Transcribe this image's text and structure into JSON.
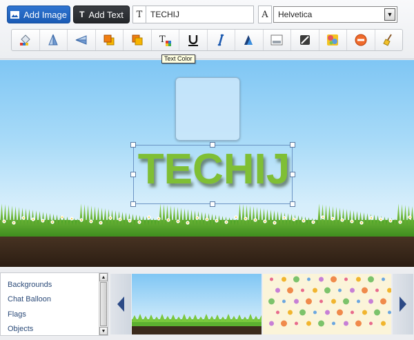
{
  "toolbar": {
    "add_image_label": "Add Image",
    "add_text_label": "Add Text",
    "text_prefix": "T",
    "text_value": "TECHIJ",
    "font_prefix": "A",
    "font_value": "Helvetica",
    "tools": [
      "fill-color-icon",
      "flip-vertical-icon",
      "flip-horizontal-icon",
      "bring-forward-icon",
      "send-backward-icon",
      "text-color-icon",
      "underline-icon",
      "italic-icon",
      "text-shadow-icon",
      "image-frame-icon",
      "no-fill-icon",
      "image-filter-icon",
      "delete-icon",
      "clear-icon"
    ],
    "tooltip": "Text Color"
  },
  "canvas": {
    "text": "TECHIJ",
    "text_color": "#7fbf35"
  },
  "categories": [
    "Backgrounds",
    "Chat Balloon",
    "Flags",
    "Objects"
  ],
  "gallery": {
    "prev_icon": "arrow-left-icon",
    "next_icon": "arrow-right-icon",
    "items": [
      "grass-sky-thumbnail",
      "polka-pattern-thumbnail"
    ]
  },
  "colors": {
    "accent_blue": "#1a5bb5",
    "dark_button": "#24272b",
    "arrow_navy": "#2c4a86"
  }
}
